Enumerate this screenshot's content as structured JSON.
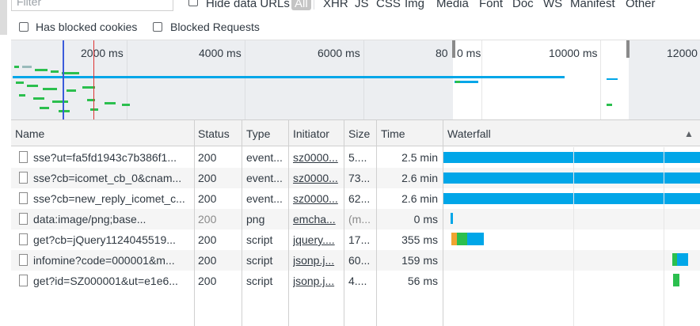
{
  "filter": {
    "placeholder": "Filter",
    "hide_data_urls_label": "Hide data URLs"
  },
  "type_filters": [
    "All",
    "XHR",
    "JS",
    "CSS",
    "Img",
    "Media",
    "Font",
    "Doc",
    "WS",
    "Manifest",
    "Other"
  ],
  "checkboxes": {
    "blocked_cookies": "Has blocked cookies",
    "blocked_requests": "Blocked Requests"
  },
  "overview": {
    "ticks": [
      "2000 ms",
      "4000 ms",
      "6000 ms",
      "80",
      "0 ms",
      "10000 ms",
      "12000"
    ]
  },
  "columns": [
    "Name",
    "Status",
    "Type",
    "Initiator",
    "Size",
    "Time",
    "Waterfall"
  ],
  "sort_indicator": "▲",
  "rows": [
    {
      "name": "sse?ut=fa5fd1943c7b386f1...",
      "status": "200",
      "type": "event...",
      "initiator": "sz0000...",
      "size": "5....",
      "time": "2.5 min",
      "dim": false
    },
    {
      "name": "sse?cb=icomet_cb_0&cnam...",
      "status": "200",
      "type": "event...",
      "initiator": "sz0000...",
      "size": "73...",
      "time": "2.6 min",
      "dim": false
    },
    {
      "name": "sse?cb=new_reply_icomet_c...",
      "status": "200",
      "type": "event...",
      "initiator": "sz0000...",
      "size": "62...",
      "time": "2.6 min",
      "dim": false
    },
    {
      "name": "data:image/png;base...",
      "status": "200",
      "type": "png",
      "initiator": "emcha...",
      "size": "(m...",
      "time": "0 ms",
      "dim": true
    },
    {
      "name": "get?cb=jQuery1124045519...",
      "status": "200",
      "type": "script",
      "initiator": "jquery....",
      "size": "17...",
      "time": "355 ms",
      "dim": false
    },
    {
      "name": "infomine?code=000001&m...",
      "status": "200",
      "type": "script",
      "initiator": "jsonp.j...",
      "size": "60...",
      "time": "159 ms",
      "dim": false
    },
    {
      "name": "get?id=SZ000001&ut=e1e6...",
      "status": "200",
      "type": "script",
      "initiator": "jsonp.j...",
      "size": "4....",
      "time": "56 ms",
      "dim": false
    }
  ],
  "colors": {
    "waiting": "#00a6e8",
    "green": "#2bbf4e",
    "orange": "#f0a430",
    "grid": "#e6e6e6"
  }
}
